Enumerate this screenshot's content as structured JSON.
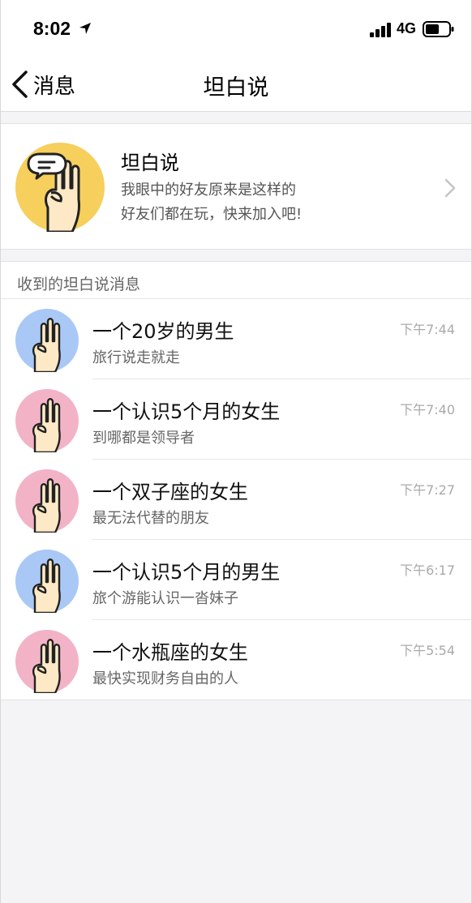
{
  "status": {
    "time": "8:02",
    "network": "4G"
  },
  "nav": {
    "back_label": "消息",
    "title": "坦白说"
  },
  "header": {
    "title": "坦白说",
    "subtitle1": "我眼中的好友原来是这样的",
    "subtitle2": "好友们都在玩，快来加入吧!"
  },
  "section": {
    "title": "收到的坦白说消息"
  },
  "messages": [
    {
      "title": "一个20岁的男生",
      "sub": "旅行说走就走",
      "time": "下午7:44",
      "avatar_color": "#a9c8f5"
    },
    {
      "title": "一个认识5个月的女生",
      "sub": "到哪都是领导者",
      "time": "下午7:40",
      "avatar_color": "#f3b3c6"
    },
    {
      "title": "一个双子座的女生",
      "sub": "最无法代替的朋友",
      "time": "下午7:27",
      "avatar_color": "#f3b3c6"
    },
    {
      "title": "一个认识5个月的男生",
      "sub": "旅个游能认识一沓妹子",
      "time": "下午6:17",
      "avatar_color": "#a9c8f5"
    },
    {
      "title": "一个水瓶座的女生",
      "sub": "最快实现财务自由的人",
      "time": "下午5:54",
      "avatar_color": "#f3b3c6"
    }
  ],
  "colors": {
    "header_avatar_bg": "#f6cf5c",
    "male_avatar_bg": "#a9c8f5",
    "female_avatar_bg": "#f3b3c6",
    "background": "#f4f4f6"
  },
  "icons": {
    "location": "location-arrow-icon",
    "signal": "signal-icon",
    "battery": "battery-icon",
    "back": "chevron-left-icon",
    "chevron": "chevron-right-icon",
    "avatar": "hand-gesture-icon"
  }
}
